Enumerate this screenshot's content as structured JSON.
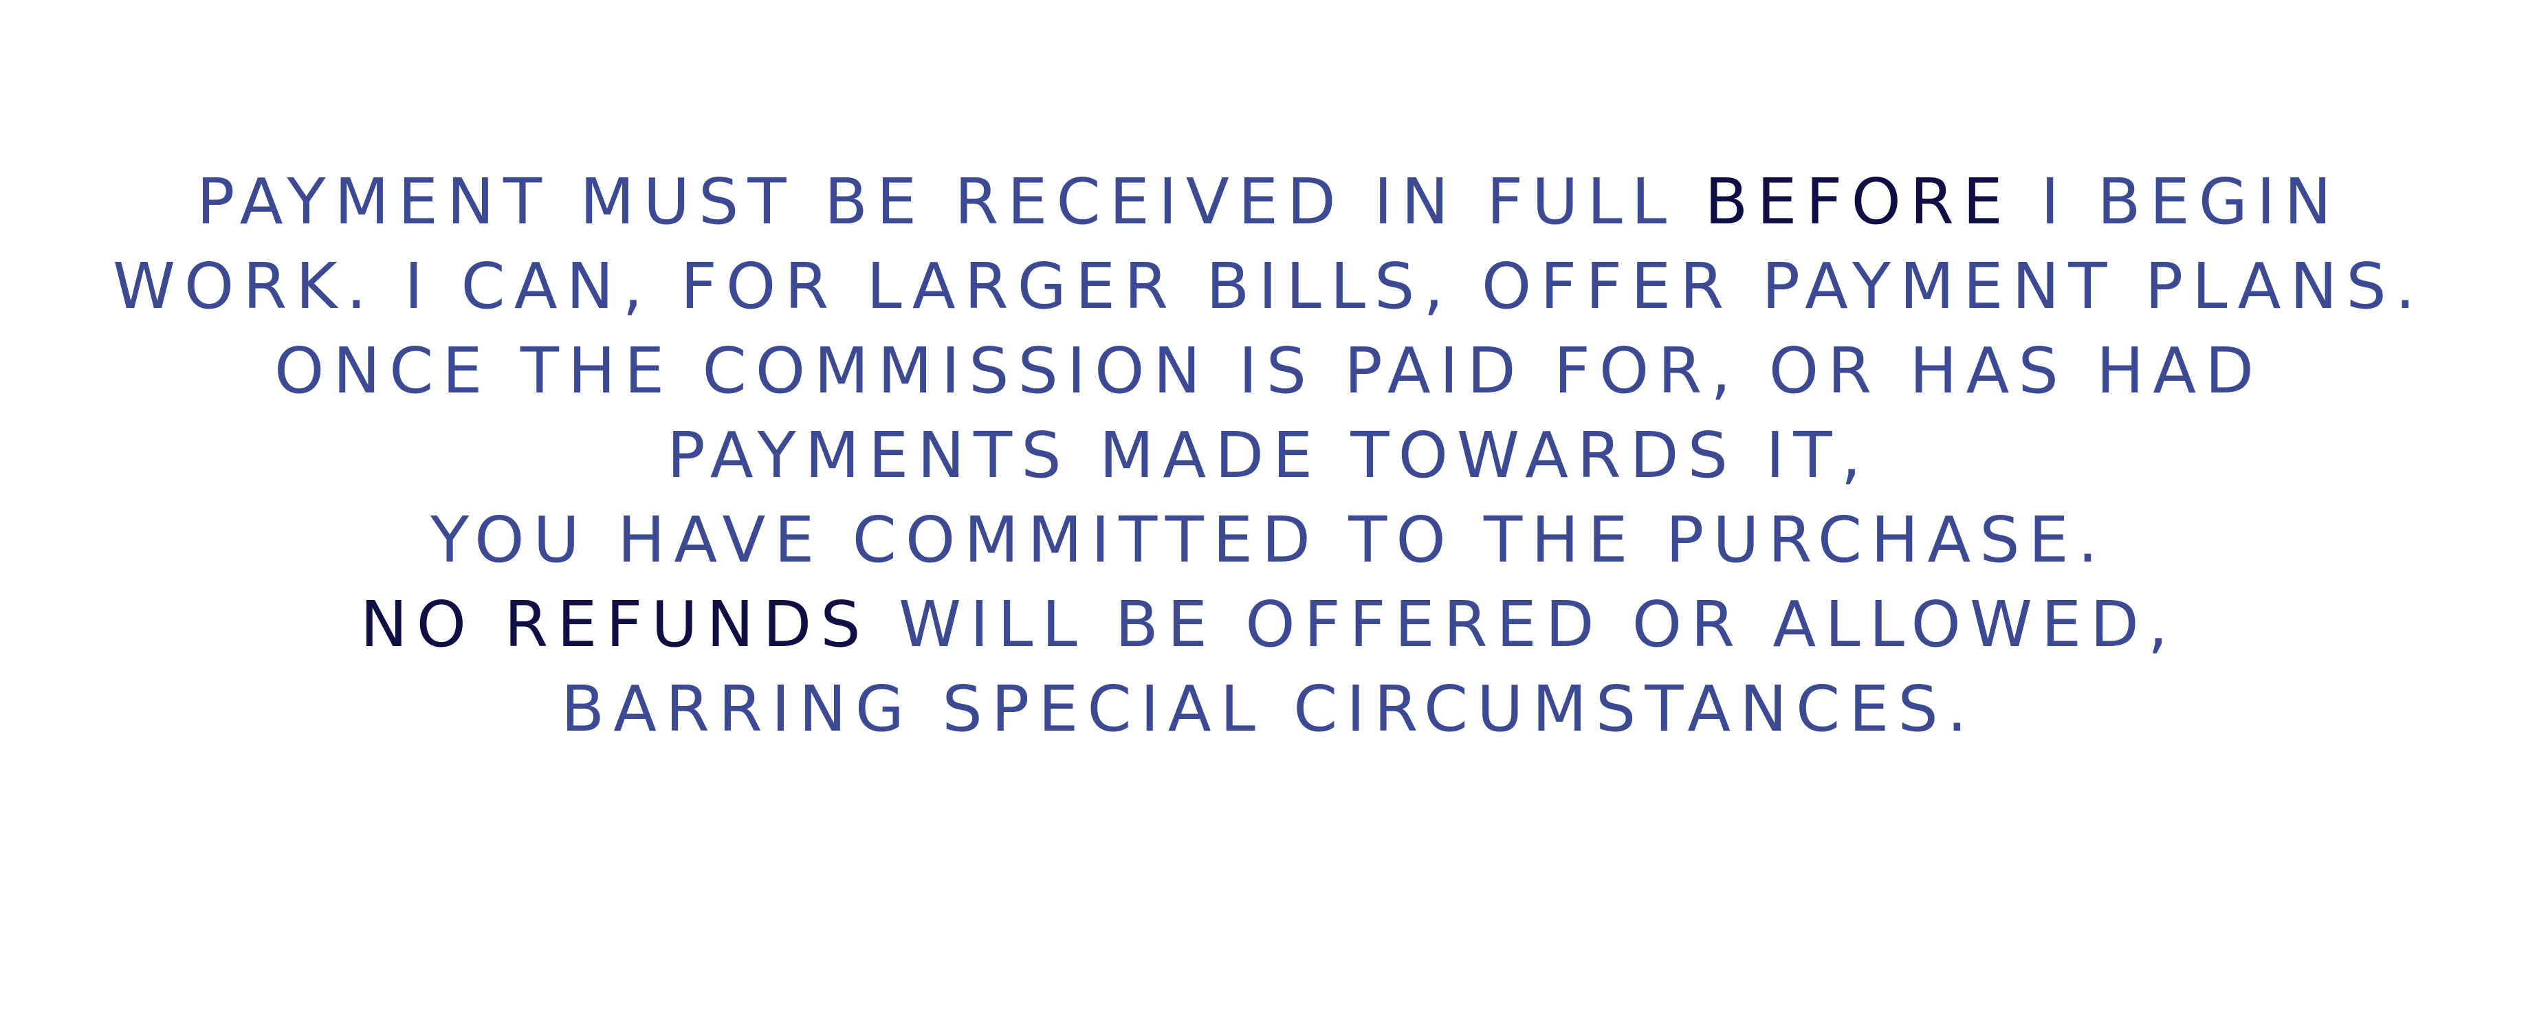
{
  "policy": {
    "line1": {
      "before": "Payment must be received in full ",
      "emphasis": "BEFORE",
      "after": " I begin"
    },
    "line2": "work. I can, for larger bills, offer payment plans.",
    "line3": "Once the commission is paid for, or has had",
    "line4": "payments made towards it,",
    "line5": "you have committed to the purchase.",
    "line6": {
      "emphasis": "NO REFUNDS",
      "after": " will be offered or allowed,"
    },
    "line7": "barring special circumstances."
  },
  "colors": {
    "text": "#3b4a92",
    "emphasis": "#0f0f45",
    "background": "#ffffff"
  }
}
